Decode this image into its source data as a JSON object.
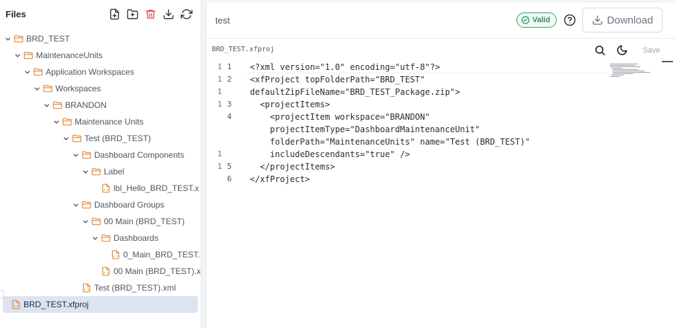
{
  "sidebar": {
    "title": "Files",
    "tools": [
      {
        "name": "new-file-icon"
      },
      {
        "name": "new-folder-icon"
      },
      {
        "name": "delete-icon"
      },
      {
        "name": "download-icon"
      },
      {
        "name": "refresh-icon"
      }
    ],
    "tree": [
      {
        "label": "BRD_TEST",
        "depth": 0,
        "type": "folder"
      },
      {
        "label": "MaintenanceUnits",
        "depth": 1,
        "type": "folder"
      },
      {
        "label": "Application Workspaces",
        "depth": 2,
        "type": "folder"
      },
      {
        "label": "Workspaces",
        "depth": 3,
        "type": "folder"
      },
      {
        "label": "BRANDON",
        "depth": 4,
        "type": "folder"
      },
      {
        "label": "Maintenance Units",
        "depth": 5,
        "type": "folder"
      },
      {
        "label": "Test (BRD_TEST)",
        "depth": 6,
        "type": "folder"
      },
      {
        "label": "Dashboard Components",
        "depth": 7,
        "type": "folder"
      },
      {
        "label": "Label",
        "depth": 8,
        "type": "folder"
      },
      {
        "label": "lbl_Hello_BRD_TEST.x",
        "depth": 9,
        "type": "file"
      },
      {
        "label": "Dashboard Groups",
        "depth": 7,
        "type": "folder"
      },
      {
        "label": "00 Main (BRD_TEST)",
        "depth": 8,
        "type": "folder"
      },
      {
        "label": "Dashboards",
        "depth": 9,
        "type": "folder"
      },
      {
        "label": "0_Main_BRD_TEST.",
        "depth": 10,
        "type": "file"
      },
      {
        "label": "00 Main (BRD_TEST).x",
        "depth": 9,
        "type": "file"
      },
      {
        "label": "Test (BRD_TEST).xml",
        "depth": 7,
        "type": "file"
      },
      {
        "label": "BRD_TEST.xfproj",
        "depth": 0,
        "type": "file",
        "selected": true
      }
    ]
  },
  "main": {
    "doc_title": "test",
    "valid_label": "Valid",
    "download_label": "Download",
    "file_name": "BRD_TEST.xfproj",
    "save_label": "Save",
    "code": [
      {
        "fold": "1",
        "ln": "1",
        "text": "<?xml version=\"1.0\" encoding=\"utf-8\"?>"
      },
      {
        "fold": "1",
        "ln": "2",
        "text": "<xfProject topFolderPath=\"BRD_TEST\""
      },
      {
        "fold": "1",
        "ln": "",
        "text": "defaultZipFileName=\"BRD_TEST_Package.zip\">"
      },
      {
        "fold": "1",
        "ln": "3",
        "text": "  <projectItems>"
      },
      {
        "fold": "",
        "ln": "4",
        "text": "    <projectItem workspace=\"BRANDON\""
      },
      {
        "fold": "",
        "ln": "",
        "text": "    projectItemType=\"DashboardMaintenanceUnit\""
      },
      {
        "fold": "",
        "ln": "",
        "text": "    folderPath=\"MaintenanceUnits\" name=\"Test (BRD_TEST)\""
      },
      {
        "fold": "1",
        "ln": "",
        "text": "    includeDescendants=\"true\" />"
      },
      {
        "fold": "1",
        "ln": "5",
        "text": "  </projectItems>"
      },
      {
        "fold": "",
        "ln": "6",
        "text": "</xfProject>"
      }
    ]
  },
  "colors": {
    "accent_red": "#e05252",
    "valid_green": "#2f8f5d",
    "folder_orange": "#e0893a",
    "selected_bg": "#dbe4f0"
  }
}
